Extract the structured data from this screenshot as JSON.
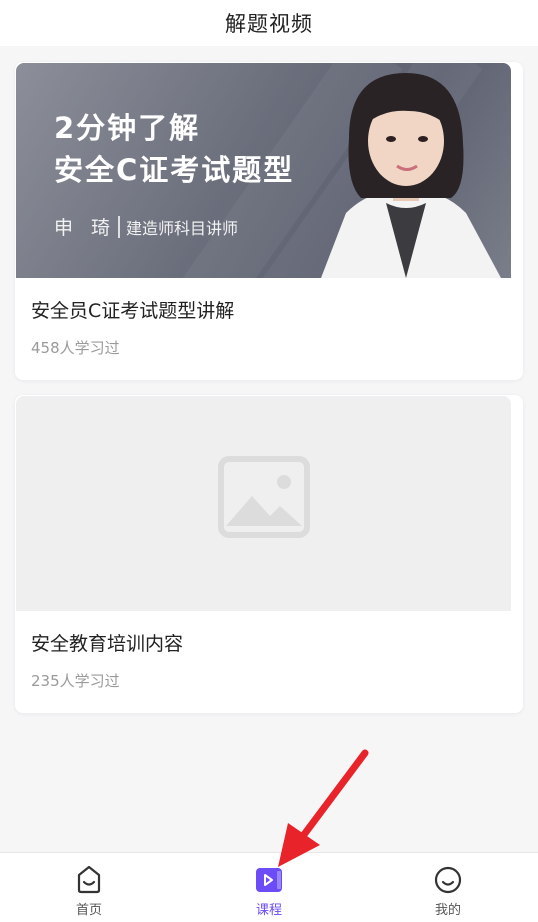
{
  "header": {
    "title": "解题视频"
  },
  "courses": [
    {
      "title": "安全员C证考试题型讲解",
      "learners": "458人学习过",
      "cover": {
        "line1": "2分钟了解",
        "line2": "安全C证考试题型",
        "teacher_name": "申 琦",
        "teacher_role": "建造师科目讲师"
      }
    },
    {
      "title": "安全教育培训内容",
      "learners": "235人学习过",
      "cover": {
        "icon": "image-placeholder-icon"
      }
    }
  ],
  "tabbar": {
    "items": [
      {
        "label": "首页",
        "icon": "home-icon",
        "active": false
      },
      {
        "label": "课程",
        "icon": "course-play-icon",
        "active": true
      },
      {
        "label": "我的",
        "icon": "profile-smile-icon",
        "active": false
      }
    ],
    "active_color": "#6b4cf6"
  },
  "annotation": {
    "color": "#e8232a"
  }
}
